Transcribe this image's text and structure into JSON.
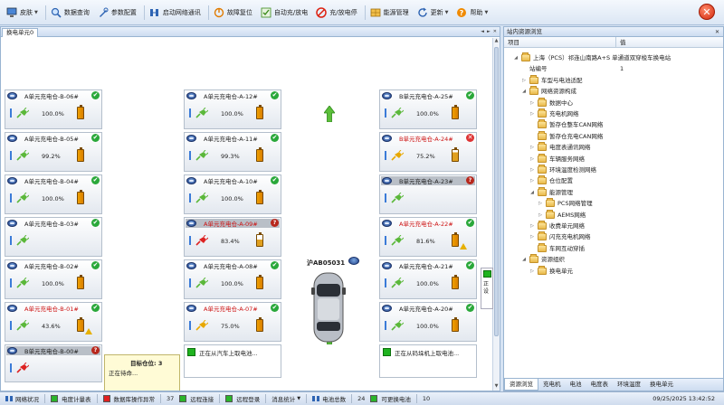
{
  "toolbar": {
    "items": [
      {
        "label": "皮肤",
        "icon": "monitor-icon",
        "dropdown": true
      },
      {
        "label": "数据查询",
        "icon": "magnifier-icon"
      },
      {
        "label": "参数配置",
        "icon": "wrench-icon"
      },
      {
        "label": "启动网络通讯",
        "icon": "network-icon"
      },
      {
        "label": "故障复位",
        "icon": "power-icon"
      },
      {
        "label": "自动充/放电",
        "icon": "check-icon"
      },
      {
        "label": "充/放电停",
        "icon": "stop-icon"
      },
      {
        "label": "能源管理",
        "icon": "grid-icon"
      },
      {
        "label": "更新",
        "icon": "refresh-icon",
        "dropdown": true
      },
      {
        "label": "帮助",
        "icon": "help-icon",
        "dropdown": true
      }
    ]
  },
  "left_panel": {
    "tab": "换电单元0",
    "controls": [
      "◄",
      "►",
      "✕"
    ]
  },
  "cells_col1": [
    {
      "title": "A单元充电仓-B-06#",
      "status": "ok",
      "pct": "100.0%",
      "batt": "full",
      "plug": "green"
    },
    {
      "title": "A单元充电仓-B-05#",
      "status": "ok",
      "pct": "99.2%",
      "batt": "full",
      "plug": "green"
    },
    {
      "title": "A单元充电仓-B-04#",
      "status": "ok",
      "pct": "100.0%",
      "batt": "full",
      "plug": "green"
    },
    {
      "title": "A单元充电仓-B-03#",
      "status": "ok",
      "pct": "",
      "batt": "none",
      "plug": "green"
    },
    {
      "title": "A单元充电仓-B-02#",
      "status": "ok",
      "pct": "100.0%",
      "batt": "full",
      "plug": "green"
    },
    {
      "title": "A单元充电仓-B-01#",
      "status": "ok",
      "pct": "43.6%",
      "batt": "warn",
      "plug": "green",
      "red": true
    }
  ],
  "cells_col2": [
    {
      "title": "A单元充电仓-A-12#",
      "status": "ok",
      "pct": "100.0%",
      "batt": "full",
      "plug": "green"
    },
    {
      "title": "A单元充电仓-A-11#",
      "status": "ok",
      "pct": "99.3%",
      "batt": "full",
      "plug": "green"
    },
    {
      "title": "A单元充电仓-A-10#",
      "status": "ok",
      "pct": "100.0%",
      "batt": "full",
      "plug": "green"
    },
    {
      "title": "A单元充电仓-A-09#",
      "status": "err",
      "pct": "83.4%",
      "batt": "low",
      "plug": "red",
      "gray": true,
      "red": true
    },
    {
      "title": "A单元充电仓-A-08#",
      "status": "ok",
      "pct": "100.0%",
      "batt": "full",
      "plug": "green"
    },
    {
      "title": "A单元充电仓-A-07#",
      "status": "ok",
      "pct": "75.0%",
      "batt": "full",
      "plug": "yellow",
      "red": true
    }
  ],
  "cells_col3": [
    {
      "title": "B单元充电仓-A-25#",
      "status": "ok",
      "pct": "100.0%",
      "batt": "full",
      "plug": "green"
    },
    {
      "title": "B单元充电仓-A-24#",
      "status": "warn",
      "pct": "75.2%",
      "batt": "lowp",
      "plug": "yellow",
      "red": true
    },
    {
      "title": "B单元充电仓-A-23#",
      "status": "err",
      "pct": "",
      "batt": "none",
      "plug": "green",
      "gray": true
    },
    {
      "title": "A单元充电仓-A-22#",
      "status": "ok",
      "pct": "81.6%",
      "batt": "warn",
      "plug": "green",
      "red": true
    },
    {
      "title": "A单元充电仓-A-21#",
      "status": "ok",
      "pct": "100.0%",
      "batt": "full",
      "plug": "green"
    },
    {
      "title": "A单元充电仓-A-20#",
      "status": "ok",
      "pct": "100.0%",
      "batt": "full",
      "plug": "green"
    }
  ],
  "bottom_cells": [
    {
      "title": "B单元充电仓-B-00#",
      "status": "err",
      "plug": "red"
    },
    {
      "text": "正在从汽车上取电池..."
    },
    {
      "text": "正在从码垛机上取电池..."
    }
  ],
  "target": {
    "title": "目标仓位: 3",
    "text": "正在待命..."
  },
  "plate": "沪AB05031",
  "sidestack": {
    "l1": "正",
    "l2": "设"
  },
  "right_panel": {
    "title": "站内资源浏览",
    "close": "✕",
    "col_item": "项目",
    "col_value": "值",
    "tree": [
      {
        "label": "上海（PCS）祁连山南路A+S 单通道双穿梭车换电站",
        "level": 0,
        "exp": "◢"
      },
      {
        "label": "站编号",
        "level": 1,
        "value": "1",
        "nofold": true
      },
      {
        "label": "车型与电池适配",
        "level": 1,
        "exp": "▷"
      },
      {
        "label": "网络资源构成",
        "level": 1,
        "exp": "◢"
      },
      {
        "label": "数据中心",
        "level": 2,
        "exp": "▷"
      },
      {
        "label": "充电机网络",
        "level": 2,
        "exp": "▷"
      },
      {
        "label": "暂存仓整车CAN网络",
        "level": 2,
        "exp": ""
      },
      {
        "label": "暂存仓充电CAN网络",
        "level": 2,
        "exp": ""
      },
      {
        "label": "电度表通讯网络",
        "level": 2,
        "exp": "▷"
      },
      {
        "label": "车辆服务网络",
        "level": 2,
        "exp": "▷"
      },
      {
        "label": "环境温度检测网络",
        "level": 2,
        "exp": "▷"
      },
      {
        "label": "仓位配置",
        "level": 2,
        "exp": "▷"
      },
      {
        "label": "能源管理",
        "level": 2,
        "exp": "◢"
      },
      {
        "label": "PCS网络管理",
        "level": 3,
        "exp": "▷"
      },
      {
        "label": "AEMS网络",
        "level": 3,
        "exp": "▷"
      },
      {
        "label": "收费单元网络",
        "level": 2,
        "exp": "▷"
      },
      {
        "label": "闪充充电机网络",
        "level": 2,
        "exp": "▷"
      },
      {
        "label": "车网互动穿插",
        "level": 2,
        "exp": ""
      },
      {
        "label": "资源组织",
        "level": 1,
        "exp": "◢"
      },
      {
        "label": "换电单元",
        "level": 2,
        "exp": "▷"
      }
    ],
    "bottom_tabs": [
      "资源浏览",
      "充电机",
      "电池",
      "电度表",
      "环境温度",
      "换电单元"
    ]
  },
  "statusbar": {
    "items": [
      {
        "label": "网络状况",
        "kind": "icon"
      },
      {
        "label": "电度计量表",
        "kind": "green"
      },
      {
        "label": "数据库操作异常",
        "kind": "red"
      },
      {
        "label": "37",
        "kind": "text"
      },
      {
        "label": "远程连接",
        "kind": "green"
      },
      {
        "label": "远程登录",
        "kind": "green"
      },
      {
        "label": "消息统计",
        "kind": "dd"
      },
      {
        "label": "电池总数",
        "kind": "icon"
      },
      {
        "label": "24",
        "kind": "text"
      },
      {
        "label": "可更换电池",
        "kind": "green"
      },
      {
        "label": "10",
        "kind": "text"
      }
    ],
    "datetime": "09/25/2025 13:42:52"
  },
  "colors": {
    "accent": "#d6e3f3",
    "ok": "#2aa83a",
    "error": "#cc1111",
    "warn": "#e6b000"
  }
}
